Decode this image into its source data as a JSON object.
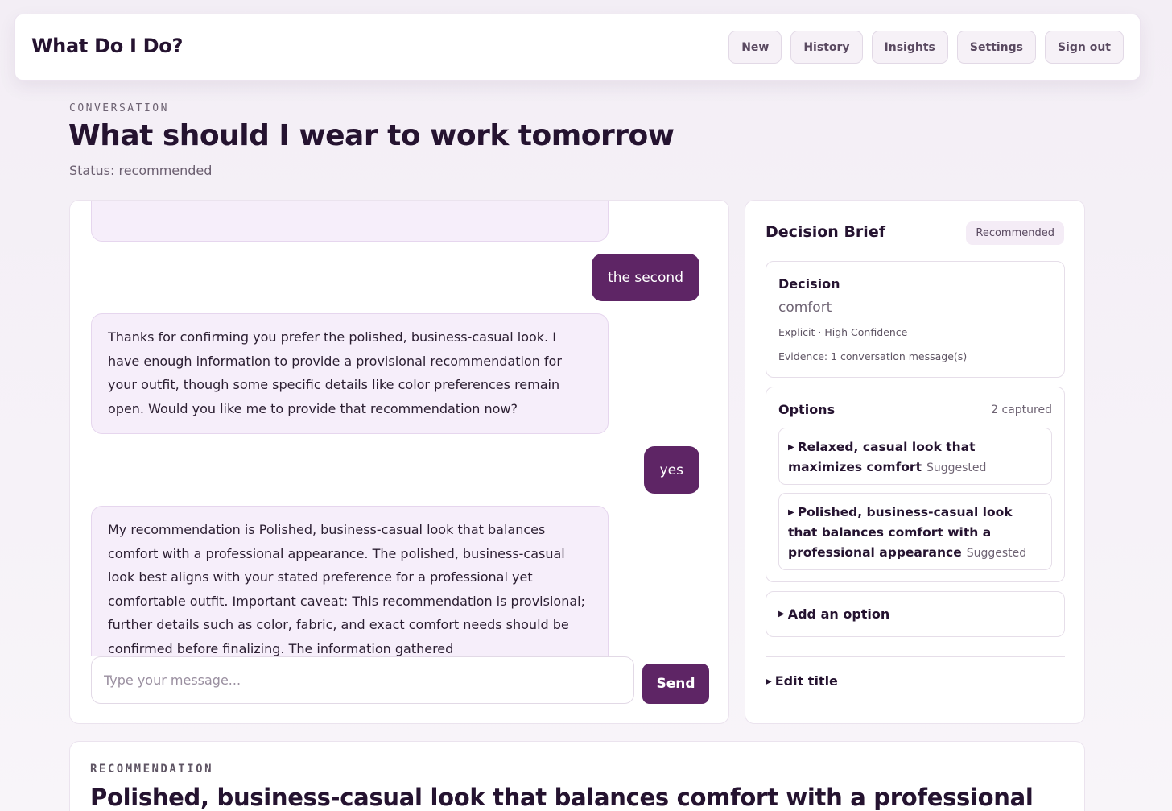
{
  "app": {
    "title": "What Do I Do?"
  },
  "nav": {
    "new": "New",
    "history": "History",
    "insights": "Insights",
    "settings": "Settings",
    "sign_out": "Sign out"
  },
  "page": {
    "eyebrow": "CONVERSATION",
    "title": "What should I wear to work tomorrow",
    "status": "Status: recommended"
  },
  "chat": {
    "messages": [
      {
        "role": "user",
        "text": "the second"
      },
      {
        "role": "assistant",
        "text": "Thanks for confirming you prefer the polished, business-casual look. I have enough information to provide a provisional recommendation for your outfit, though some specific details like color preferences remain open. Would you like me to provide that recommendation now?"
      },
      {
        "role": "user",
        "text": "yes"
      },
      {
        "role": "assistant",
        "text": "My recommendation is Polished, business-casual look that balances comfort with a professional appearance. The polished, business-casual look best aligns with your stated preference for a professional yet comfortable outfit. Important caveat: This recommendation is provisional; further details such as color, fabric, and exact comfort needs should be confirmed before finalizing. The information gathered"
      }
    ],
    "input_placeholder": "Type your message...",
    "send_label": "Send"
  },
  "brief": {
    "title": "Decision Brief",
    "badge": "Recommended",
    "decision": {
      "label": "Decision",
      "value": "comfort",
      "meta": "Explicit · High Confidence",
      "evidence": "Evidence: 1 conversation message(s)"
    },
    "options": {
      "label": "Options",
      "count": "2 captured",
      "items": [
        {
          "text": "Relaxed, casual look that maximizes comfort",
          "tag": "Suggested"
        },
        {
          "text": "Polished, business-casual look that balances comfort with a professional appearance",
          "tag": "Suggested"
        }
      ]
    },
    "add_option": "Add an option",
    "edit_title": "Edit title"
  },
  "recommendation": {
    "eyebrow": "RECOMMENDATION",
    "title": "Polished, business-casual look that balances comfort with a professional"
  },
  "colors": {
    "accent": "#5e2565",
    "bubble": "#f6eefa",
    "text": "#251330"
  }
}
